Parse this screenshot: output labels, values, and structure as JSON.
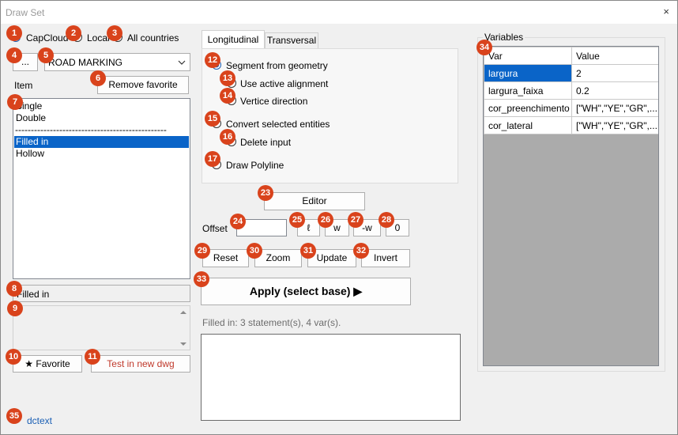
{
  "window": {
    "title": "Draw Set",
    "close_glyph": "×"
  },
  "source": {
    "options": [
      "CapCloud",
      "Local",
      "All countries"
    ],
    "selected": "CapCloud"
  },
  "browse_button": "...",
  "category": {
    "selected": "ROAD MARKING"
  },
  "item_label": "Item",
  "remove_favorite": "Remove favorite",
  "items": {
    "group1": [
      "Single",
      "Double"
    ],
    "separator": "------------------------------------------------",
    "group2": [
      "Filled in",
      "Hollow"
    ],
    "selected": "Filled in"
  },
  "selected_item_text": "Filled in",
  "favorite_button": "★ Favorite",
  "test_button": "Test in new dwg",
  "footer_link": "dctext",
  "tabs": [
    "Longitudinal",
    "Transversal"
  ],
  "active_tab": "Longitudinal",
  "longitudinal": {
    "segment_from_geometry": "Segment from geometry",
    "use_active_alignment": "Use active alignment",
    "vertice_direction": "Vertice direction",
    "convert_selected": "Convert selected entities",
    "delete_input": "Delete input",
    "draw_polyline": "Draw Polyline"
  },
  "editor_button": "Editor",
  "offset": {
    "label": "Offset",
    "value": "",
    "buttons": [
      "ℓ",
      "w",
      "-w",
      "0"
    ]
  },
  "actions": {
    "reset": "Reset",
    "zoom": "Zoom",
    "update": "Update",
    "invert": "Invert"
  },
  "apply_button": "Apply (select base) ▶",
  "status": "Filled in: 3 statement(s), 4 var(s).",
  "variables": {
    "title": "Variables",
    "headers": [
      "Var",
      "Value"
    ],
    "rows": [
      [
        "largura",
        "2"
      ],
      [
        "largura_faixa",
        "0.2"
      ],
      [
        "cor_preenchimento",
        "[\"WH\",\"YE\",\"GR\",..."
      ],
      [
        "cor_lateral",
        "[\"WH\",\"YE\",\"GR\",..."
      ]
    ]
  },
  "annotations": [
    "1",
    "2",
    "3",
    "4",
    "5",
    "6",
    "7",
    "8",
    "9",
    "10",
    "11",
    "12",
    "13",
    "14",
    "15",
    "16",
    "17",
    "23",
    "24",
    "25",
    "26",
    "27",
    "28",
    "29",
    "30",
    "31",
    "32",
    "33",
    "34",
    "35"
  ],
  "colors": {
    "accent": "#1a5fb4",
    "selection": "#0a64c8",
    "badge": "#d9431c",
    "grid_bg": "#ababab",
    "test_text": "#c0392b"
  },
  "icons": {
    "chevron": "chevron-down-icon",
    "scroll_up": "scroll-up-icon",
    "scroll_down": "scroll-down-icon"
  }
}
